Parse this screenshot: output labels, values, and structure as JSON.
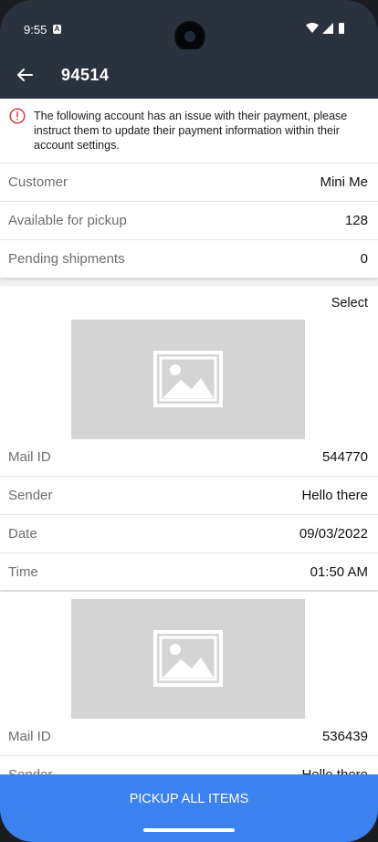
{
  "status_bar": {
    "time": "9:55",
    "notification_icon": "a-letter-icon",
    "icons": [
      "wifi-icon",
      "signal-icon",
      "battery-icon"
    ]
  },
  "app_bar": {
    "back_icon": "back-arrow-icon",
    "title": "94514"
  },
  "alert": {
    "icon": "info-circle-icon",
    "text": "The following account has an issue with their payment, please instruct them to update their payment information within their account settings.",
    "color": "#d32f2f"
  },
  "summary": {
    "customer_label": "Customer",
    "customer_value": "Mini Me",
    "available_label": "Available for pickup",
    "available_value": "128",
    "pending_label": "Pending shipments",
    "pending_value": "0"
  },
  "mail_items": [
    {
      "select_label": "Select",
      "image_icon": "image-placeholder-icon",
      "mail_id_label": "Mail ID",
      "mail_id": "544770",
      "sender_label": "Sender",
      "sender": "Hello there",
      "date_label": "Date",
      "date": "09/03/2022",
      "time_label": "Time",
      "time": "01:50 AM"
    },
    {
      "image_icon": "image-placeholder-icon",
      "mail_id_label": "Mail ID",
      "mail_id": "536439",
      "sender_label": "Sender",
      "sender": "Hello there"
    }
  ],
  "footer": {
    "pickup_button_label": "PICKUP ALL ITEMS",
    "button_color": "#3b82f0"
  }
}
